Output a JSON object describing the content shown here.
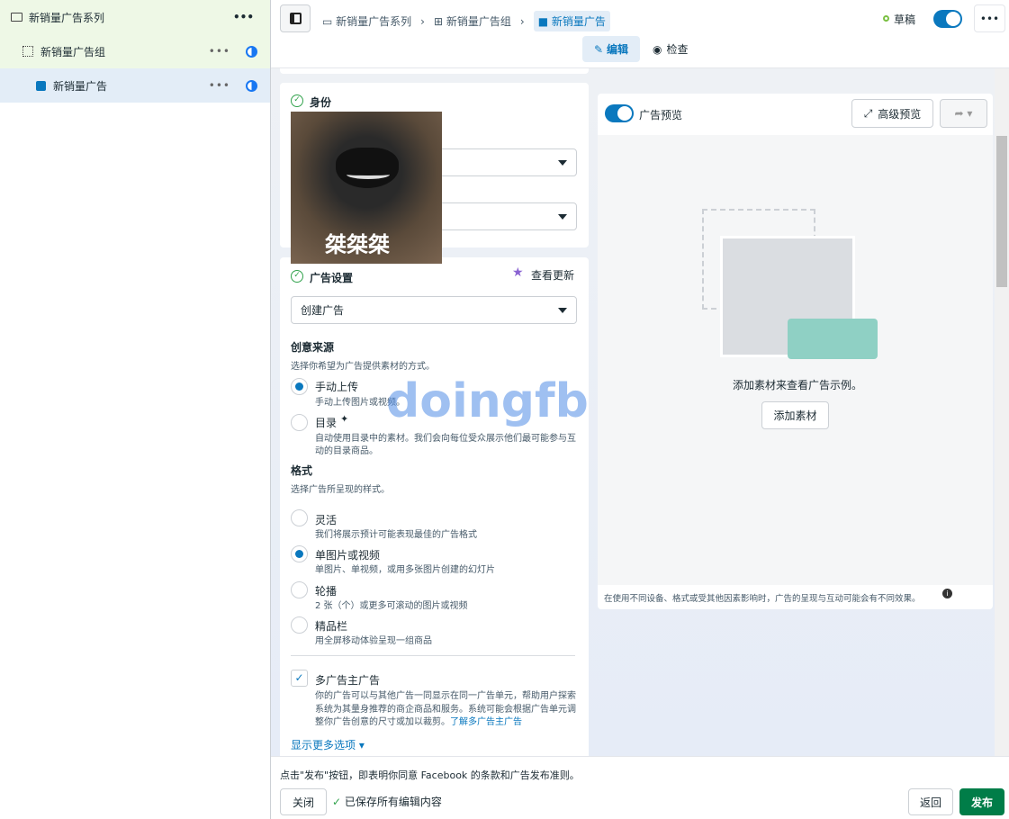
{
  "sidebar": {
    "items": [
      {
        "label": "新销量广告系列",
        "icon": "folder-icon"
      },
      {
        "label": "新销量广告组",
        "icon": "grid-icon"
      },
      {
        "label": "新销量广告",
        "icon": "ad-icon"
      }
    ]
  },
  "breadcrumb": [
    "新销量广告系列",
    "新销量广告组",
    "新销量广告"
  ],
  "status": {
    "label": "草稿",
    "color": "#7bc043"
  },
  "tabs": {
    "edit": "编辑",
    "review": "检查"
  },
  "identity": {
    "title": "身份"
  },
  "sticker": {
    "text": "桀桀桀"
  },
  "watermark": "doingfb",
  "ad_settings": {
    "title": "广告设置",
    "updates": "查看更新",
    "select_value": "创建广告",
    "creative_source": {
      "title": "创意来源",
      "desc": "选择你希望为广告提供素材的方式。",
      "options": [
        {
          "label": "手动上传",
          "desc": "手动上传图片或视频。",
          "selected": true
        },
        {
          "label": "目录",
          "desc": "自动使用目录中的素材。我们会向每位受众展示他们最可能参与互",
          "desc2": "动的目录商品。",
          "selected": false
        }
      ]
    },
    "format": {
      "title": "格式",
      "desc": "选择广告所呈现的样式。",
      "options": [
        {
          "label": "灵活",
          "desc": "我们将展示预计可能表现最佳的广告格式",
          "selected": false
        },
        {
          "label": "单图片或视频",
          "desc": "单图片、单视频，或用多张图片创建的幻灯片",
          "selected": true
        },
        {
          "label": "轮播",
          "desc": "2 张（个）或更多可滚动的图片或视频",
          "selected": false
        },
        {
          "label": "精品栏",
          "desc": "用全屏移动体验呈现一组商品",
          "selected": false
        }
      ]
    },
    "multi_advertiser": {
      "label": "多广告主广告",
      "checked": true,
      "desc1": "你的广告可以与其他广告一同显示在同一广告单元，帮助用户探索",
      "desc2": "系统为其量身推荐的商企商品和服务。系统可能会根据广告单元调",
      "desc3": "整你广告创意的尺寸或加以裁剪。",
      "link": "了解多广告主广告"
    },
    "more_options": "显示更多选项"
  },
  "preview": {
    "toggle_label": "广告预览",
    "advanced": "高级预览",
    "empty_text": "添加素材来查看广告示例。",
    "add_button": "添加素材",
    "disclaimer": "在使用不同设备、格式或受其他因素影响时，广告的呈现与互动可能会有不同效果。"
  },
  "footer": {
    "terms": "点击\"发布\"按钮，即表明你同意 Facebook 的条款和广告发布准则。",
    "close": "关闭",
    "saved": "已保存所有编辑内容",
    "back": "返回",
    "publish": "发布",
    "publish_color": "#007d48"
  }
}
